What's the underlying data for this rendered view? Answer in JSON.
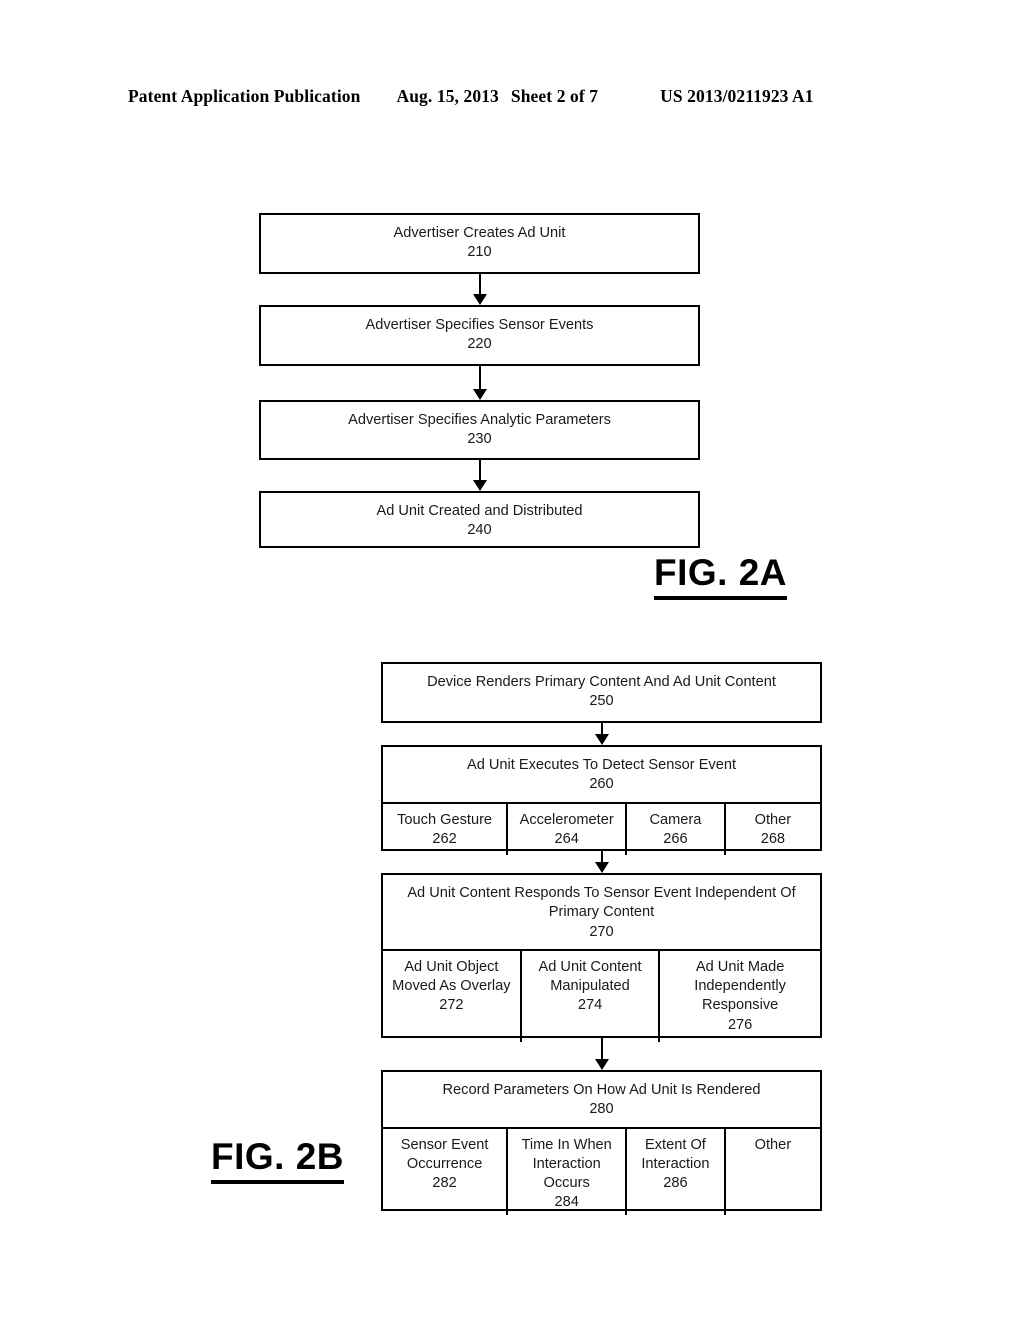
{
  "header": {
    "publication": "Patent Application Publication",
    "date": "Aug. 15, 2013",
    "sheet": "Sheet 2 of 7",
    "pub_number": "US 2013/0211923 A1"
  },
  "fig2a": {
    "label": "FIG. 2A",
    "steps": [
      {
        "title": "Advertiser Creates Ad Unit",
        "ref": "210"
      },
      {
        "title": "Advertiser Specifies Sensor Events",
        "ref": "220"
      },
      {
        "title": "Advertiser Specifies Analytic Parameters",
        "ref": "230"
      },
      {
        "title": "Ad Unit Created and Distributed",
        "ref": "240"
      }
    ]
  },
  "fig2b": {
    "label": "FIG. 2B",
    "steps": [
      {
        "title": "Device Renders Primary Content And Ad Unit Content",
        "ref": "250",
        "subcells": []
      },
      {
        "title": "Ad Unit Executes To Detect Sensor Event",
        "ref": "260",
        "subcells": [
          {
            "title": "Touch Gesture",
            "ref": "262"
          },
          {
            "title": "Accelerometer",
            "ref": "264"
          },
          {
            "title": "Camera",
            "ref": "266"
          },
          {
            "title": "Other",
            "ref": "268"
          }
        ]
      },
      {
        "title": "Ad Unit Content Responds To Sensor Event Independent Of Primary Content",
        "ref": "270",
        "subcells": [
          {
            "title": "Ad Unit Object Moved As Overlay",
            "ref": "272"
          },
          {
            "title": "Ad Unit Content Manipulated",
            "ref": "274"
          },
          {
            "title": "Ad Unit Made Independently Responsive",
            "ref": "276"
          }
        ]
      },
      {
        "title": "Record Parameters On How Ad Unit Is Rendered",
        "ref": "280",
        "subcells": [
          {
            "title": "Sensor Event Occurrence",
            "ref": "282"
          },
          {
            "title": "Time In When Interaction Occurs",
            "ref": "284"
          },
          {
            "title": "Extent Of Interaction",
            "ref": "286"
          },
          {
            "title": "Other",
            "ref": ""
          }
        ]
      }
    ]
  },
  "colors": {
    "ink": "#000000",
    "page": "#ffffff",
    "text": "#1a1a1a"
  }
}
